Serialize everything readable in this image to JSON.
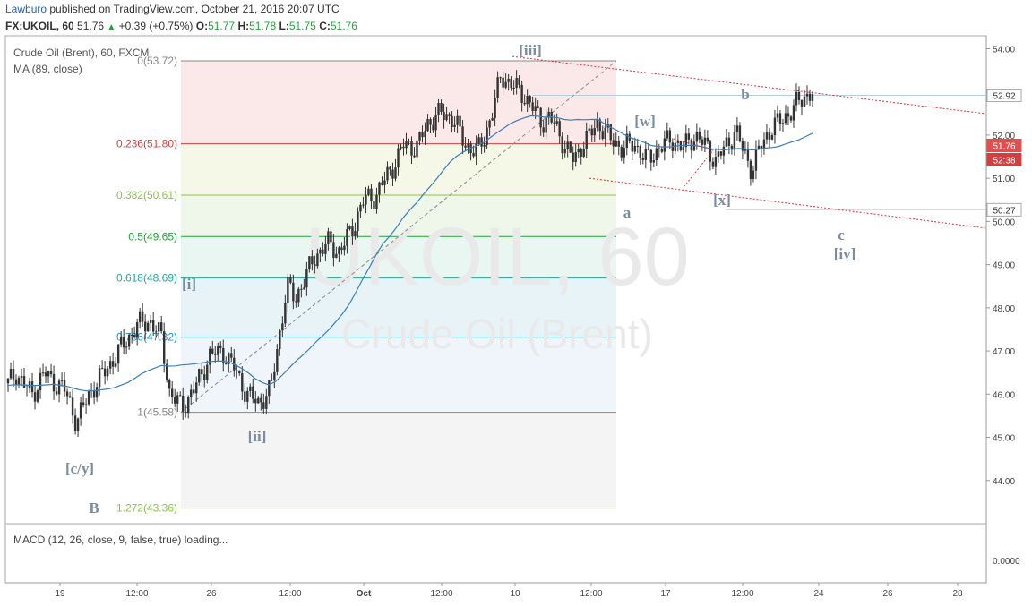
{
  "header": {
    "author": "Lawburo",
    "published": "published on TradingView.com, October 21, 2016 20:07 UTC",
    "symbol": "FX:UKOIL, 60",
    "last": "51.76",
    "change": "+0.39 (+0.75%)",
    "o_label": "O:",
    "o_value": "51.77",
    "h_label": "H:",
    "h_value": "51.78",
    "l_label": "L:",
    "l_value": "51.75",
    "c_label": "C:",
    "c_value": "51.76"
  },
  "legend": {
    "title": "Crude Oil (Brent), 60, FXCM",
    "ma": "MA (89, close)",
    "macd": "MACD (12, 26, close, 9, false, true) loading..."
  },
  "watermark": {
    "line1": "UKOIL, 60",
    "line2": "Crude Oil (Brent)"
  },
  "colors": {
    "up": "#22a33a",
    "ma": "#3b7fb8",
    "channel": "#e0303a",
    "price_tag": "#e05050",
    "time_tag": "#d04040",
    "fib_red": "#d94040",
    "fib_green": "#8bc34a",
    "fib_teal": "#26a69a",
    "fib_blue": "#2196c8",
    "fib_gray": "#888888",
    "wave_label": "#7a8c9e"
  },
  "chart_data": {
    "type": "candlestick",
    "title": "Crude Oil (Brent), 60, FXCM",
    "y_axis": {
      "ticks": [
        "54.00",
        "53.00",
        "52.00",
        "51.00",
        "50.00",
        "49.00",
        "48.00",
        "47.00",
        "46.00",
        "45.00",
        "44.00"
      ],
      "range": [
        43.0,
        54.3
      ]
    },
    "x_axis": {
      "ticks": [
        "19",
        "12:00",
        "26",
        "12:00",
        "Oct",
        "12:00",
        "10",
        "12:00",
        "17",
        "12:00",
        "24",
        "26",
        "28"
      ]
    },
    "price_tags": [
      {
        "label": "52.92",
        "value": 52.92,
        "style": "plain"
      },
      {
        "label": "51.76",
        "value": 51.76,
        "style": "last"
      },
      {
        "label": "52:38",
        "value": 51.43,
        "style": "countdown"
      },
      {
        "label": "50.27",
        "value": 50.27,
        "style": "plain"
      }
    ],
    "macd_axis": {
      "ticks": [
        "0.0000"
      ]
    },
    "fib_levels": [
      {
        "label": "0(53.72)",
        "value": 53.72
      },
      {
        "label": "0.236(51.80)",
        "value": 51.8
      },
      {
        "label": "0.382(50.61)",
        "value": 50.61
      },
      {
        "label": "0.5(49.65)",
        "value": 49.65
      },
      {
        "label": "0.618(48.69)",
        "value": 48.69
      },
      {
        "label": "0.786(47.32)",
        "value": 47.32
      },
      {
        "label": "1(45.58)",
        "value": 45.58
      },
      {
        "label": "1.272(43.36)",
        "value": 43.36
      }
    ],
    "wave_labels": [
      {
        "text": "[iii]",
        "t": 0.42,
        "v": 54.33
      },
      {
        "text": "b",
        "t": 0.6,
        "v": 53.3
      },
      {
        "text": "[w]",
        "t": 0.5,
        "v": 52.6
      },
      {
        "text": "[x]",
        "t": 0.56,
        "v": 50.9
      },
      {
        "text": "a",
        "t": 0.484,
        "v": 50.55
      },
      {
        "text": "c",
        "t": 0.652,
        "v": 50.05
      },
      {
        "text": "[iv]",
        "t": 0.652,
        "v": 49.55
      },
      {
        "text": "[i]",
        "t": 0.09,
        "v": 48.85
      },
      {
        "text": "[ii]",
        "t": 0.114,
        "v": 45.3
      },
      {
        "text": "[c/y]",
        "t": 0.025,
        "v": 44.55
      },
      {
        "text": "B",
        "t": 0.027,
        "v": 43.6
      }
    ],
    "close_path": [
      [
        0.0,
        46.25
      ],
      [
        0.01,
        46.5
      ],
      [
        0.02,
        46.2
      ],
      [
        0.03,
        46.0
      ],
      [
        0.045,
        46.5
      ],
      [
        0.055,
        46.3
      ],
      [
        0.07,
        46.1
      ],
      [
        0.085,
        45.35
      ],
      [
        0.1,
        46.0
      ],
      [
        0.115,
        46.4
      ],
      [
        0.13,
        46.8
      ],
      [
        0.145,
        47.2
      ],
      [
        0.16,
        47.6
      ],
      [
        0.175,
        47.7
      ],
      [
        0.19,
        47.3
      ],
      [
        0.2,
        46.0
      ],
      [
        0.215,
        45.7
      ],
      [
        0.23,
        46.1
      ],
      [
        0.25,
        46.9
      ],
      [
        0.265,
        47.0
      ],
      [
        0.28,
        46.6
      ],
      [
        0.295,
        46.0
      ],
      [
        0.31,
        45.8
      ],
      [
        0.325,
        46.1
      ],
      [
        0.335,
        47.3
      ],
      [
        0.345,
        48.5
      ],
      [
        0.355,
        48.2
      ],
      [
        0.365,
        48.6
      ],
      [
        0.38,
        49.2
      ],
      [
        0.395,
        49.5
      ],
      [
        0.41,
        49.3
      ],
      [
        0.425,
        49.8
      ],
      [
        0.44,
        50.5
      ],
      [
        0.455,
        50.6
      ],
      [
        0.47,
        51.1
      ],
      [
        0.48,
        51.4
      ],
      [
        0.49,
        51.8
      ],
      [
        0.505,
        51.7
      ],
      [
        0.52,
        52.3
      ],
      [
        0.535,
        52.5
      ],
      [
        0.55,
        52.4
      ],
      [
        0.565,
        51.8
      ],
      [
        0.58,
        51.6
      ],
      [
        0.59,
        52.0
      ],
      [
        0.6,
        52.6
      ],
      [
        0.61,
        53.4
      ],
      [
        0.62,
        53.2
      ],
      [
        0.635,
        53.0
      ],
      [
        0.65,
        52.6
      ],
      [
        0.66,
        52.3
      ],
      [
        0.67,
        52.4
      ],
      [
        0.68,
        52.1
      ],
      [
        0.69,
        51.7
      ],
      [
        0.7,
        51.4
      ],
      [
        0.71,
        51.8
      ],
      [
        0.72,
        52.0
      ],
      [
        0.73,
        52.3
      ],
      [
        0.745,
        51.9
      ],
      [
        0.76,
        51.7
      ],
      [
        0.775,
        51.8
      ],
      [
        0.79,
        51.4
      ],
      [
        0.805,
        51.7
      ],
      [
        0.82,
        51.9
      ],
      [
        0.835,
        51.7
      ],
      [
        0.85,
        52.0
      ],
      [
        0.865,
        51.7
      ],
      [
        0.875,
        51.4
      ],
      [
        0.89,
        51.8
      ],
      [
        0.9,
        52.1
      ],
      [
        0.91,
        51.6
      ],
      [
        0.92,
        51.2
      ],
      [
        0.93,
        51.7
      ],
      [
        0.945,
        52.2
      ],
      [
        0.955,
        52.3
      ],
      [
        0.965,
        52.5
      ],
      [
        0.975,
        52.7
      ],
      [
        0.985,
        52.9
      ],
      [
        0.995,
        53.0
      ]
    ]
  }
}
